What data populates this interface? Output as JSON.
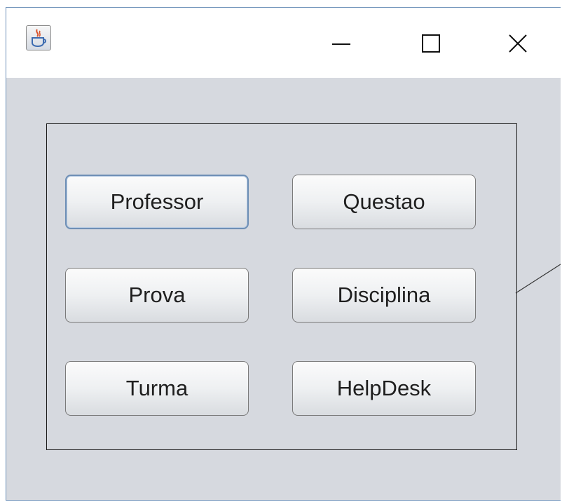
{
  "window": {
    "icon": "java-coffee-icon",
    "controls": {
      "minimize": "minimize-icon",
      "maximize": "maximize-icon",
      "close": "close-icon"
    }
  },
  "buttons": {
    "professor": "Professor",
    "questao": "Questao",
    "prova": "Prova",
    "disciplina": "Disciplina",
    "turma": "Turma",
    "helpdesk": "HelpDesk"
  },
  "colors": {
    "window_background": "#d6d9df",
    "focus_border": "#6e8fb5"
  }
}
